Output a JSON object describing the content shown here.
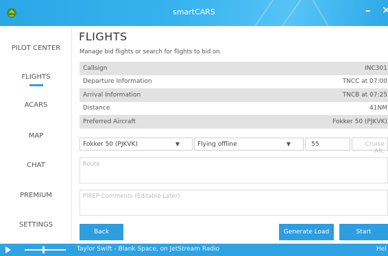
{
  "window": {
    "title": "smartCARS",
    "minimize_glyph": "–",
    "close_glyph": "✕",
    "icon": "app-logo-icon"
  },
  "sidebar": {
    "items": [
      {
        "label": "PILOT CENTER",
        "active": false
      },
      {
        "label": "FLIGHTS",
        "active": true
      },
      {
        "label": "ACARS",
        "active": false
      },
      {
        "label": "MAP",
        "active": false
      },
      {
        "label": "CHAT",
        "active": false
      },
      {
        "label": "PREMIUM",
        "active": false
      },
      {
        "label": "SETTINGS",
        "active": false
      }
    ]
  },
  "main": {
    "title": "FLIGHTS",
    "subtitle": "Manage bid flights or search for flights to bid on.",
    "info": [
      {
        "label": "Callsign",
        "value": "INC301"
      },
      {
        "label": "Departure Information",
        "value": "TNCC at 07:00"
      },
      {
        "label": "Arrival Information",
        "value": "TNCB at 07:25"
      },
      {
        "label": "Distance",
        "value": "41NM"
      },
      {
        "label": "Preferred Aircraft",
        "value": "Fokker 50 (PJKVK)"
      }
    ],
    "aircraft_select": {
      "value": "Fokker 50 (PJKVK)"
    },
    "network_select": {
      "value": "Flying offline"
    },
    "passengers_input": {
      "value": "55"
    },
    "cruise_alt_input": {
      "placeholder": "Cruise Alt."
    },
    "route_field": {
      "placeholder": "Route"
    },
    "comments_field": {
      "placeholder": "PIREP Comments (Editable Later)"
    },
    "buttons": {
      "back": "Back",
      "generate_load": "Generate Load",
      "start": "Start"
    }
  },
  "player": {
    "now_playing": "Taylor Swift - Blank Space, on JetStream Radio",
    "help": "Hel",
    "volume": 0.45
  },
  "colors": {
    "accent": "#2d9ee0",
    "titlebar": "#36b2ee",
    "row_shade": "#e2e2e2"
  }
}
